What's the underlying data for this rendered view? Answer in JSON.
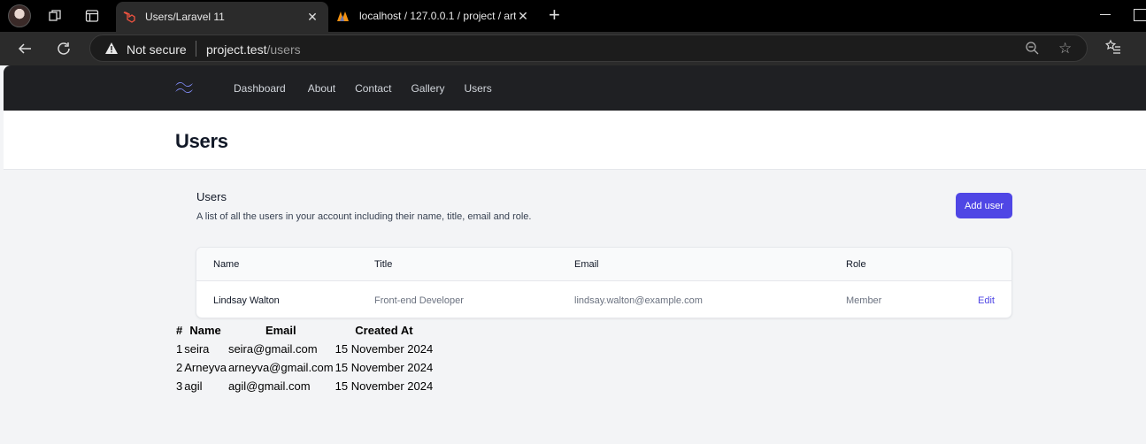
{
  "browser": {
    "tabs": [
      {
        "title": "Users/Laravel 11",
        "active": true
      },
      {
        "title": "localhost / 127.0.0.1 / project / art",
        "active": false
      }
    ],
    "address": {
      "security": "Not secure",
      "host": "project.test",
      "path": "/users"
    }
  },
  "nav": {
    "links": [
      "Dashboard",
      "About",
      "Contact",
      "Gallery",
      "Users"
    ]
  },
  "header": {
    "title": "Users"
  },
  "section": {
    "title": "Users",
    "description": "A list of all the users in your account including their name, title, email and role.",
    "add_button": "Add user"
  },
  "card_table": {
    "columns": [
      "Name",
      "Title",
      "Email",
      "Role"
    ],
    "row": {
      "name": "Lindsay Walton",
      "title": "Front-end Developer",
      "email": "lindsay.walton@example.com",
      "role": "Member",
      "action": "Edit"
    }
  },
  "raw_table": {
    "columns": [
      "#",
      "Name",
      "Email",
      "Created At"
    ],
    "rows": [
      [
        "1",
        "seira",
        "seira@gmail.com",
        "15 November 2024"
      ],
      [
        "2",
        "Arneyva",
        "arneyva@gmail.com",
        "15 November 2024"
      ],
      [
        "3",
        "agil",
        "agil@gmail.com",
        "15 November 2024"
      ]
    ]
  },
  "colors": {
    "accent": "#4f46e5",
    "nav_bg": "#1f2023",
    "page_bg": "#f3f4f6"
  }
}
